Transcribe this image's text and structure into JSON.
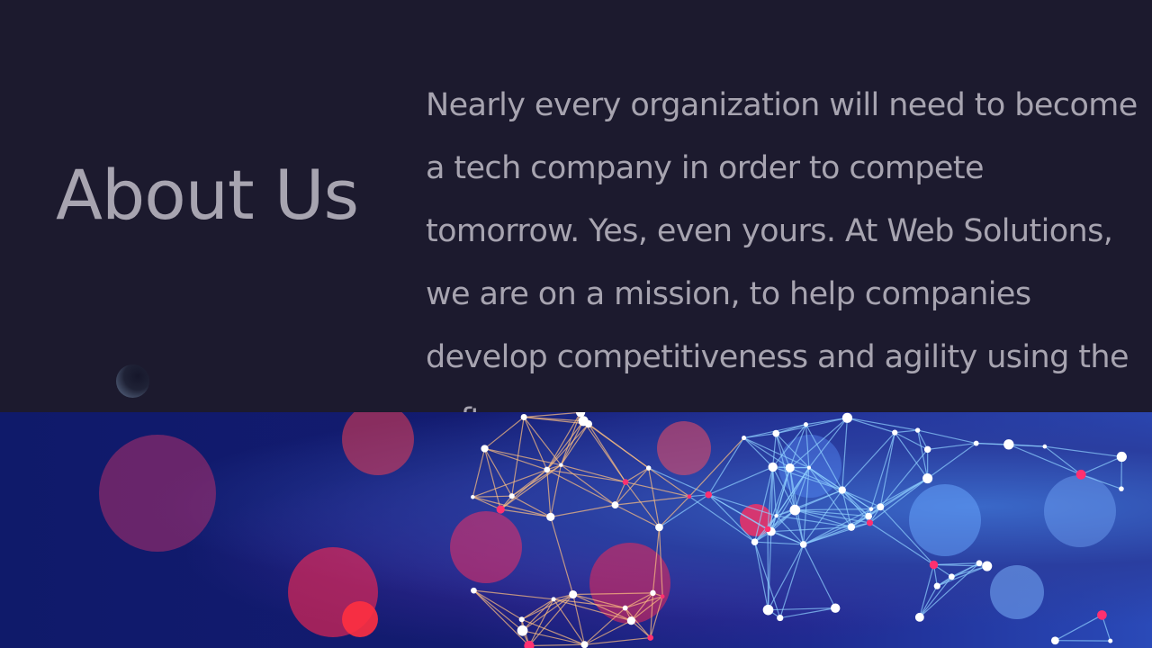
{
  "slide": {
    "title": "About Us",
    "body": "Nearly every organization will need to become a tech company in order to compete tomorrow. Yes, even yours. At Web Solutions, we are on a mission, to help companies develop competitiveness and agility using the software.",
    "colors": {
      "background": "#1c1a2e",
      "text": "#a7a4b0"
    },
    "image": "network-bokeh-image"
  }
}
